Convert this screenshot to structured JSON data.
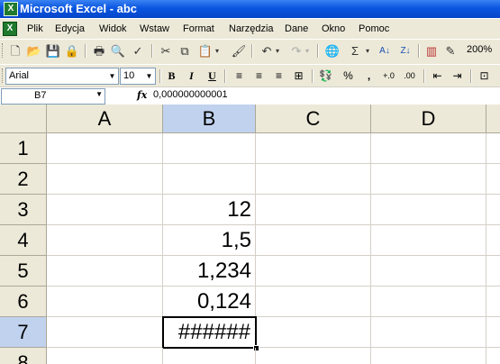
{
  "window": {
    "title": "Microsoft Excel - abc",
    "app_icon_glyph": "X"
  },
  "menu": {
    "items": [
      "Plik",
      "Edycja",
      "Widok",
      "Wstaw",
      "Format",
      "Narzędzia",
      "Dane",
      "Okno",
      "Pomoc"
    ]
  },
  "toolbar": {
    "zoom": "200%"
  },
  "format_toolbar": {
    "font_name": "Arial",
    "font_size": "10",
    "bold": "B",
    "italic": "I",
    "underline": "U",
    "percent": "%",
    "comma": ","
  },
  "formula_bar": {
    "name_box": "B7",
    "fx_label": "fx",
    "value": "0,000000000001"
  },
  "grid": {
    "columns": [
      "A",
      "B",
      "C",
      "D"
    ],
    "selected_column": "B",
    "rows": [
      "1",
      "2",
      "3",
      "4",
      "5",
      "6",
      "7",
      "8"
    ],
    "selected_row": "7",
    "cells": {
      "B3": "12",
      "B4": "1,5",
      "B5": "1,234",
      "B6": "0,124",
      "B7": "######"
    }
  }
}
